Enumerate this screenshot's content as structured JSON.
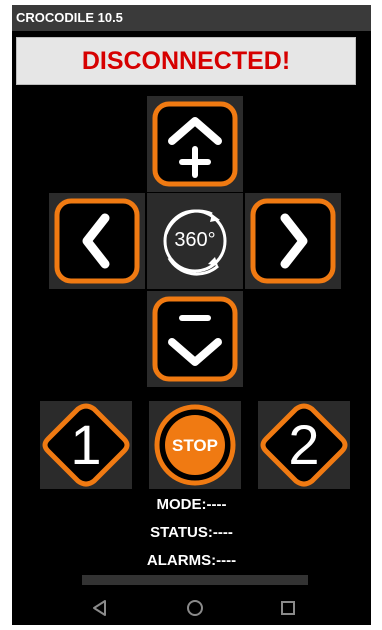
{
  "app": {
    "title": "CROCODILE 10.5"
  },
  "connection": {
    "status_text": "DISCONNECTED!"
  },
  "controls": {
    "rotate_label": "360°",
    "stop_label": "STOP",
    "preset1_label": "1",
    "preset2_label": "2"
  },
  "info": {
    "mode": "MODE:----",
    "status": "STATUS:----",
    "alarms": "ALARMS:----"
  },
  "icons": {
    "up": "chevron-up-plus",
    "down": "chevron-down-minus",
    "left": "chevron-left",
    "right": "chevron-right",
    "rotate": "rotate-360",
    "back": "back-triangle",
    "home": "home-circle",
    "recent": "recent-square"
  },
  "colors": {
    "accent": "#f07a12",
    "background": "#000000",
    "title_bar": "#3a3a3a",
    "status_text": "#d60000",
    "pad_bg": "#2b2b2b"
  }
}
